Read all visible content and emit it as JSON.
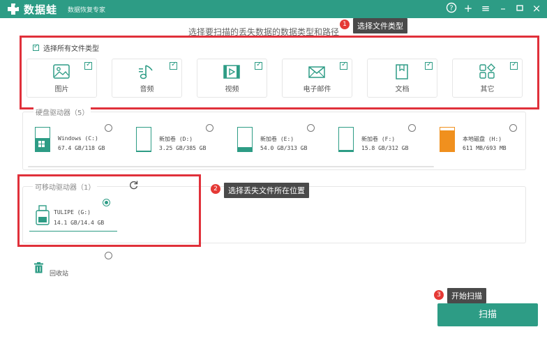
{
  "app": {
    "name": "数据蛙",
    "subtitle": "数据恢复专家"
  },
  "window_controls": [
    "help-icon",
    "plus-icon",
    "menu-icon",
    "minimize-icon",
    "restore-icon",
    "close-icon"
  ],
  "instruction": "选择要扫描的丢失数据的数据类型和路径",
  "callouts": [
    {
      "num": "1",
      "text": "选择文件类型"
    },
    {
      "num": "2",
      "text": "选择丢失文件所在位置"
    },
    {
      "num": "3",
      "text": "开始扫描"
    }
  ],
  "file_types": {
    "select_all_label": "选择所有文件类型",
    "select_all_checked": true,
    "items": [
      {
        "label": "图片",
        "icon": "image-icon",
        "checked": true
      },
      {
        "label": "音频",
        "icon": "music-icon",
        "checked": true
      },
      {
        "label": "视频",
        "icon": "video-icon",
        "checked": true
      },
      {
        "label": "电子邮件",
        "icon": "mail-icon",
        "checked": true
      },
      {
        "label": "文档",
        "icon": "document-icon",
        "checked": true
      },
      {
        "label": "其它",
        "icon": "other-icon",
        "checked": true
      }
    ]
  },
  "hard_drives": {
    "label": "硬盘驱动器（5）",
    "items": [
      {
        "name": "Windows (C:)",
        "size": "67.4 GB/118 GB",
        "used": 0.57,
        "color": "#2d9c85",
        "has_win_logo": true
      },
      {
        "name": "新加卷 (D:)",
        "size": "3.25 GB/385 GB",
        "used": 0.01,
        "color": "#2d9c85"
      },
      {
        "name": "新加卷 (E:)",
        "size": "54.0 GB/313 GB",
        "used": 0.17,
        "color": "#2d9c85"
      },
      {
        "name": "新加卷 (F:)",
        "size": "15.8 GB/312 GB",
        "used": 0.05,
        "color": "#2d9c85"
      },
      {
        "name": "本地磁盘 (H:)",
        "size": "611 MB/693 MB",
        "used": 0.88,
        "color": "#f0901e"
      }
    ]
  },
  "removable": {
    "label": "可移动驱动器（1）",
    "items": [
      {
        "name": "TULIPE (G:)",
        "size": "14.1 GB/14.4 GB",
        "selected": true
      }
    ]
  },
  "recycle": {
    "label": "回收站"
  },
  "scan_button": "扫描",
  "colors": {
    "accent": "#2d9c85",
    "highlight_red": "#e0303a",
    "orange": "#f0901e"
  }
}
